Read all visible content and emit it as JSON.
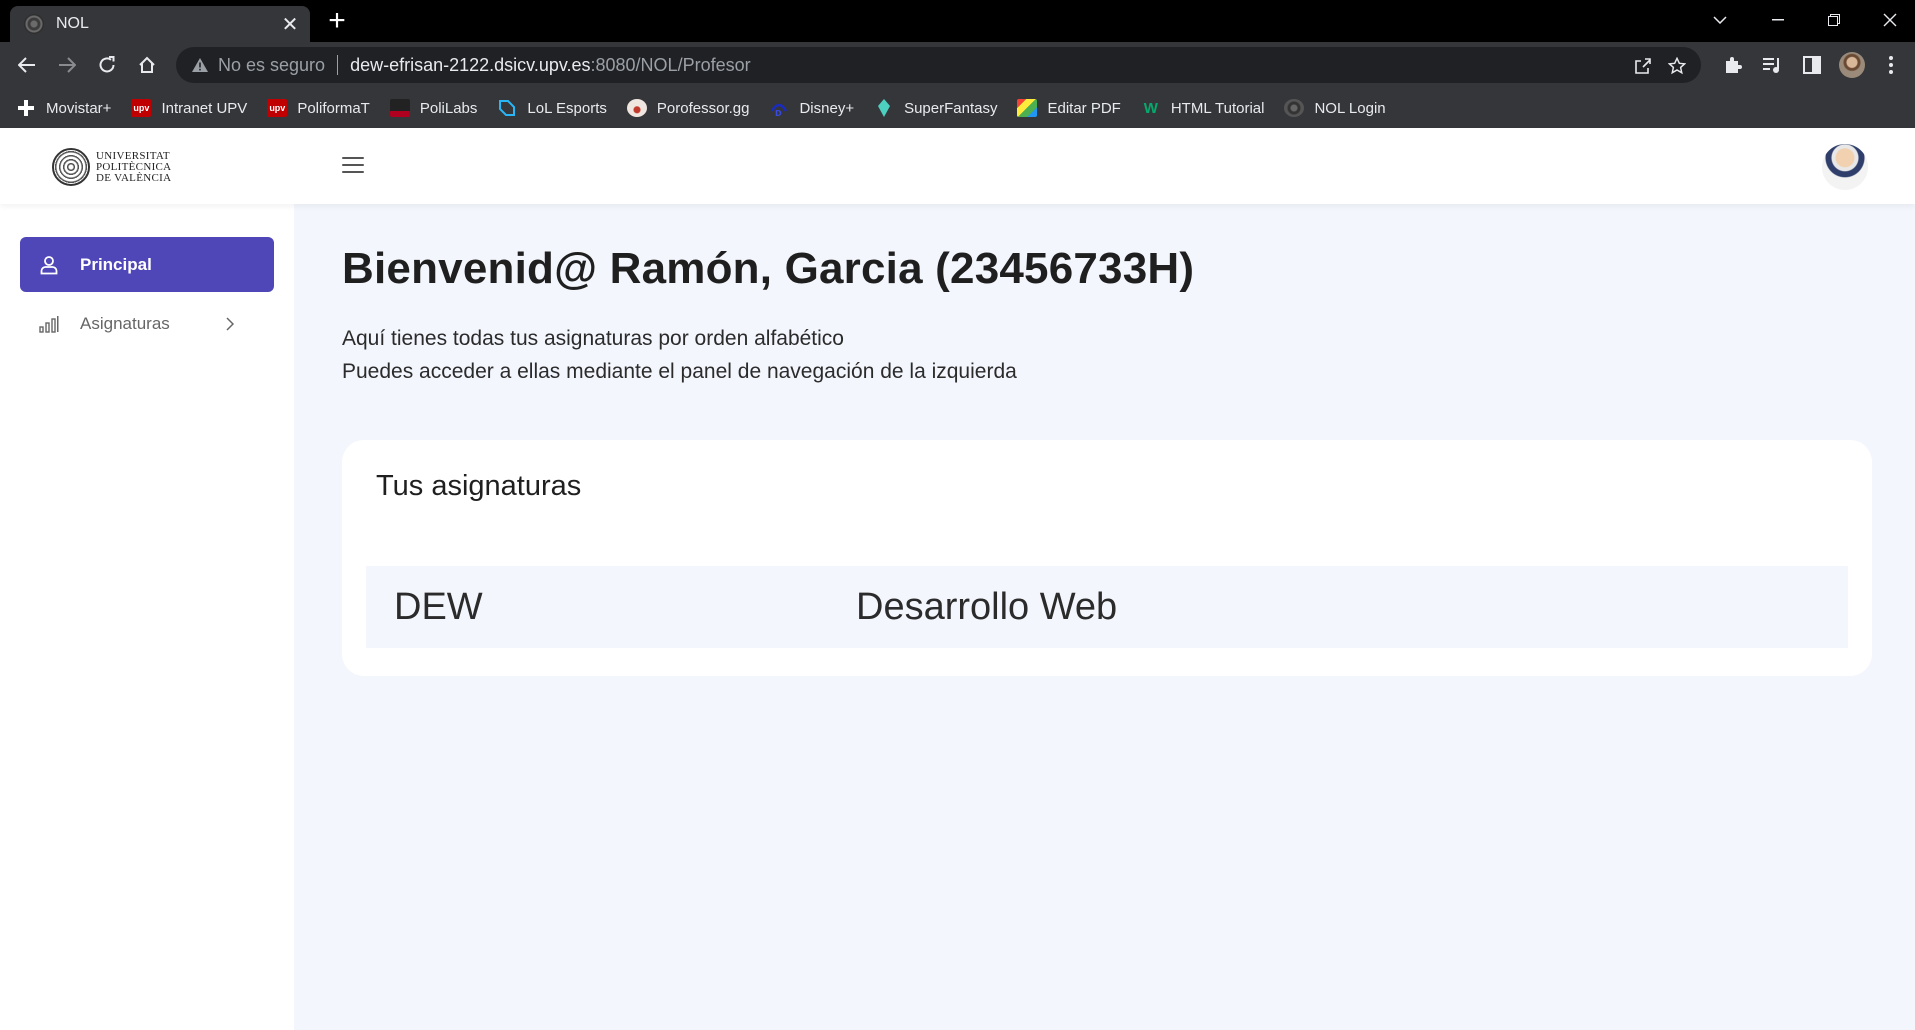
{
  "browser": {
    "tab_title": "NOL",
    "url_security": "No es seguro",
    "url_host": "dew-efrisan-2122.dsicv.upv.es",
    "url_path": ":8080/NOL/Profesor",
    "bookmarks": [
      {
        "label": "Movistar+",
        "icon": "plus-icon",
        "color": "#ffffff"
      },
      {
        "label": "Intranet UPV",
        "icon": "upv-icon",
        "color": "#c00000"
      },
      {
        "label": "PoliformaT",
        "icon": "upv-icon",
        "color": "#c00000"
      },
      {
        "label": "PoliLabs",
        "icon": "lab-icon",
        "color": "#b00020"
      },
      {
        "label": "LoL Esports",
        "icon": "lol-icon",
        "color": "#29b6f6"
      },
      {
        "label": "Porofessor.gg",
        "icon": "poro-icon",
        "color": "#e0e0e0"
      },
      {
        "label": "Disney+",
        "icon": "disney-icon",
        "color": "#1a2bbf"
      },
      {
        "label": "SuperFantasy",
        "icon": "fantasy-icon",
        "color": "#4dd0c0"
      },
      {
        "label": "Editar PDF",
        "icon": "pdf-icon",
        "color": "#f4a020"
      },
      {
        "label": "HTML Tutorial",
        "icon": "w3-icon",
        "color": "#04aa6d"
      },
      {
        "label": "NOL Login",
        "icon": "nol-icon",
        "color": "#555555"
      }
    ]
  },
  "header": {
    "logo_lines": [
      "UNIVERSITAT",
      "POLITÈCNICA",
      "DE VALÈNCIA"
    ]
  },
  "sidebar": {
    "items": [
      {
        "label": "Principal",
        "icon": "user-icon",
        "active": true
      },
      {
        "label": "Asignaturas",
        "icon": "bar-chart-icon",
        "active": false
      }
    ]
  },
  "main": {
    "title": "Bienvenid@ Ramón, Garcia (23456733H)",
    "intro_line1": "Aquí tienes todas tus asignaturas por orden alfabético",
    "intro_line2": "Puedes acceder a ellas mediante el panel de navegación de la izquierda",
    "card_title": "Tus asignaturas",
    "courses": [
      {
        "code": "DEW",
        "name": "Desarrollo Web"
      }
    ]
  },
  "colors": {
    "accent": "#4f46b8",
    "main_bg": "#f3f6fd",
    "chrome_dark": "#35363a"
  }
}
